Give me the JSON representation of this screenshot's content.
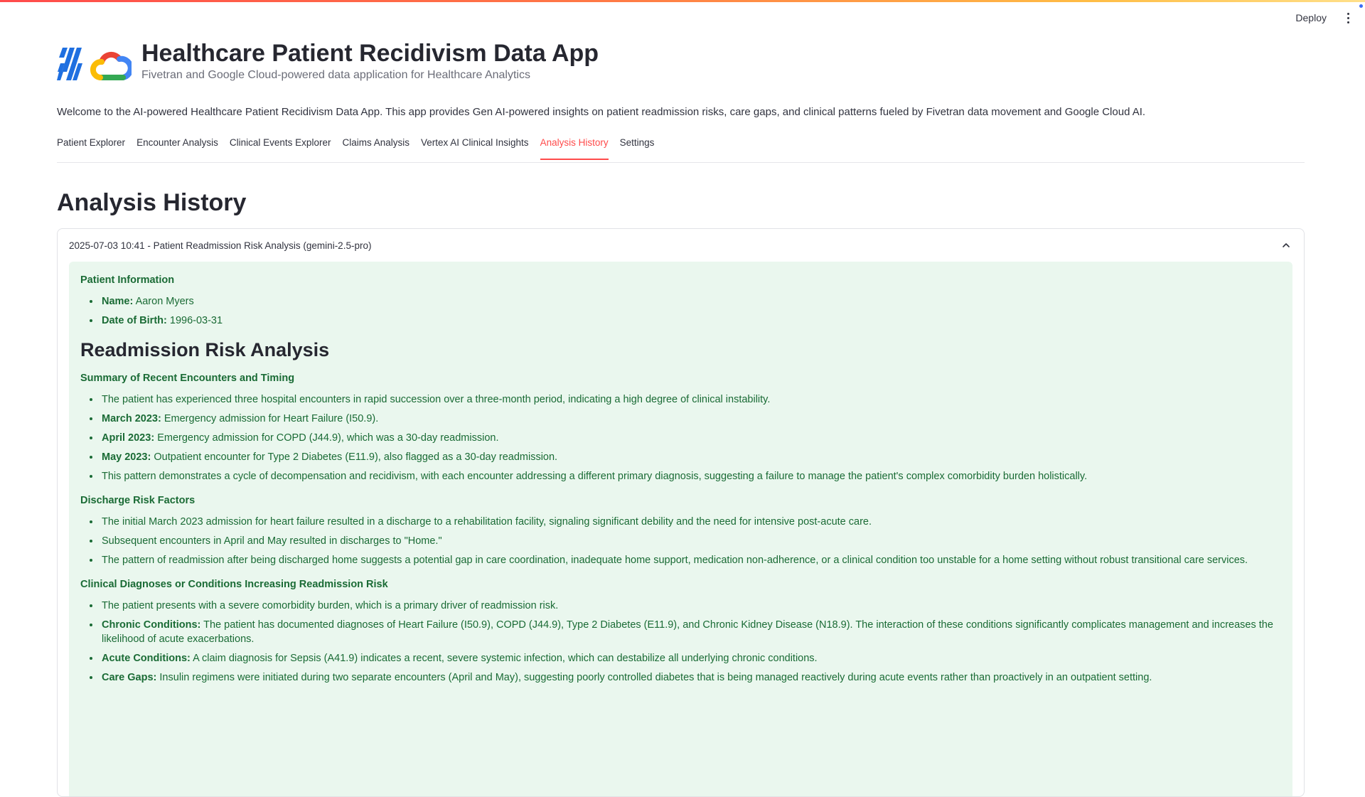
{
  "header": {
    "deploy_label": "Deploy"
  },
  "app": {
    "title": "Healthcare Patient Recidivism Data App",
    "subtitle": "Fivetran and Google Cloud-powered data application for Healthcare Analytics",
    "welcome": "Welcome to the AI-powered Healthcare Patient Recidivism Data App. This app provides Gen AI-powered insights on patient readmission risks, care gaps, and clinical patterns fueled by Fivetran data movement and Google Cloud AI."
  },
  "tabs": [
    {
      "label": "Patient Explorer"
    },
    {
      "label": "Encounter Analysis"
    },
    {
      "label": "Clinical Events Explorer"
    },
    {
      "label": "Claims Analysis"
    },
    {
      "label": "Vertex AI Clinical Insights"
    },
    {
      "label": "Analysis History",
      "active": true
    },
    {
      "label": "Settings"
    }
  ],
  "page": {
    "title": "Analysis History"
  },
  "expander": {
    "label": "2025-07-03 10:41 - Patient Readmission Risk Analysis (gemini-2.5-pro)",
    "patient_info_heading": "Patient Information",
    "name_label": "Name:",
    "name_value": "Aaron Myers",
    "dob_label": "Date of Birth:",
    "dob_value": "1996-03-31",
    "analysis_title": "Readmission Risk Analysis",
    "summary_heading": "Summary of Recent Encounters and Timing",
    "summary_items": [
      {
        "label": "",
        "text": "The patient has experienced three hospital encounters in rapid succession over a three-month period, indicating a high degree of clinical instability."
      },
      {
        "label": "March 2023:",
        "text": "Emergency admission for Heart Failure (I50.9)."
      },
      {
        "label": "April 2023:",
        "text": "Emergency admission for COPD (J44.9), which was a 30-day readmission."
      },
      {
        "label": "May 2023:",
        "text": "Outpatient encounter for Type 2 Diabetes (E11.9), also flagged as a 30-day readmission."
      },
      {
        "label": "",
        "text": "This pattern demonstrates a cycle of decompensation and recidivism, with each encounter addressing a different primary diagnosis, suggesting a failure to manage the patient's complex comorbidity burden holistically."
      }
    ],
    "discharge_heading": "Discharge Risk Factors",
    "discharge_items": [
      "The initial March 2023 admission for heart failure resulted in a discharge to a rehabilitation facility, signaling significant debility and the need for intensive post-acute care.",
      "Subsequent encounters in April and May resulted in discharges to \"Home.\"",
      "The pattern of readmission after being discharged home suggests a potential gap in care coordination, inadequate home support, medication non-adherence, or a clinical condition too unstable for a home setting without robust transitional care services."
    ],
    "clinical_heading": "Clinical Diagnoses or Conditions Increasing Readmission Risk",
    "clinical_items": [
      {
        "label": "",
        "text": "The patient presents with a severe comorbidity burden, which is a primary driver of readmission risk."
      },
      {
        "label": "Chronic Conditions:",
        "text": "The patient has documented diagnoses of Heart Failure (I50.9), COPD (J44.9), Type 2 Diabetes (E11.9), and Chronic Kidney Disease (N18.9). The interaction of these conditions significantly complicates management and increases the likelihood of acute exacerbations."
      },
      {
        "label": "Acute Conditions:",
        "text": "A claim diagnosis for Sepsis (A41.9) indicates a recent, severe systemic infection, which can destabilize all underlying chronic conditions."
      },
      {
        "label": "Care Gaps:",
        "text": "Insulin regimens were initiated during two separate encounters (April and May), suggesting poorly controlled diabetes that is being managed reactively during acute events rather than proactively in an outpatient setting."
      }
    ]
  },
  "colors": {
    "accent": "#ff4b4b",
    "success_bg": "#eaf7ee",
    "success_text": "#1a6b35"
  }
}
